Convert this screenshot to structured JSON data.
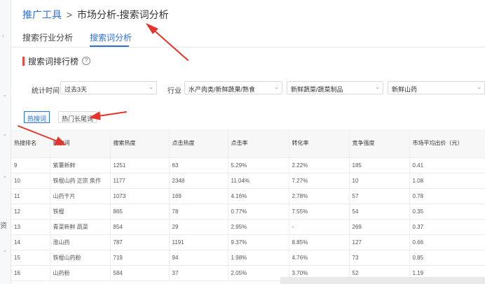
{
  "breadcrumb": {
    "root": "推广工具",
    "sep": ">",
    "current": "市场分析-搜索词分析"
  },
  "tabs": [
    {
      "label": "搜索行业分析",
      "active": false
    },
    {
      "label": "搜索词分析",
      "active": true
    }
  ],
  "section": {
    "title": "搜索词排行榜",
    "help": "?"
  },
  "filters": {
    "time_label": "统计时间",
    "time_value": "过去3天",
    "industry_label": "行业",
    "cat1": "水产肉类/新鲜蔬果/熟食",
    "cat2": "新鲜蔬菜/蔬菜制品",
    "cat3": "新鲜山药"
  },
  "subtabs": [
    {
      "label": "热搜词",
      "active": true
    },
    {
      "label": "热门长尾词",
      "active": false
    }
  ],
  "table": {
    "headers": [
      "热搜排名",
      "搜索词",
      "搜索热度",
      "点击热度",
      "点击率",
      "转化率",
      "竞争强度",
      "市场平均出价（元）"
    ],
    "rows": [
      [
        "9",
        "紫薯新鲜",
        "1251",
        "63",
        "5.29%",
        "2.22%",
        "185",
        "0.41"
      ],
      [
        "10",
        "铁棍山药 正宗 焦作",
        "1177",
        "2348",
        "11.04%",
        "7.27%",
        "10",
        "1.08"
      ],
      [
        "11",
        "山药干片",
        "1073",
        "169",
        "4.16%",
        "2.78%",
        "57",
        "0.78"
      ],
      [
        "12",
        "铁棍",
        "865",
        "78",
        "0.77%",
        "7.55%",
        "54",
        "0.35"
      ],
      [
        "13",
        "青菜新鲜 蔬菜",
        "854",
        "29",
        "2.95%",
        "-",
        "269",
        "0.37"
      ],
      [
        "14",
        "淮山药",
        "787",
        "1191",
        "9.37%",
        "8.85%",
        "127",
        "0.66"
      ],
      [
        "15",
        "铁棍山药粉",
        "719",
        "94",
        "1.98%",
        "4.76%",
        "73",
        "0.85"
      ],
      [
        "16",
        "山药粉",
        "584",
        "37",
        "2.05%",
        "3.70%",
        "52",
        "1.19"
      ]
    ]
  },
  "left_rail": {
    "char": "资"
  },
  "colors": {
    "accent": "#2f6fd6",
    "section_bar": "#e94b3c",
    "annotation_arrow": "#e5342b"
  },
  "icons": {
    "help": "question-circle-icon",
    "select_arrow": "chevron-down-icon"
  }
}
